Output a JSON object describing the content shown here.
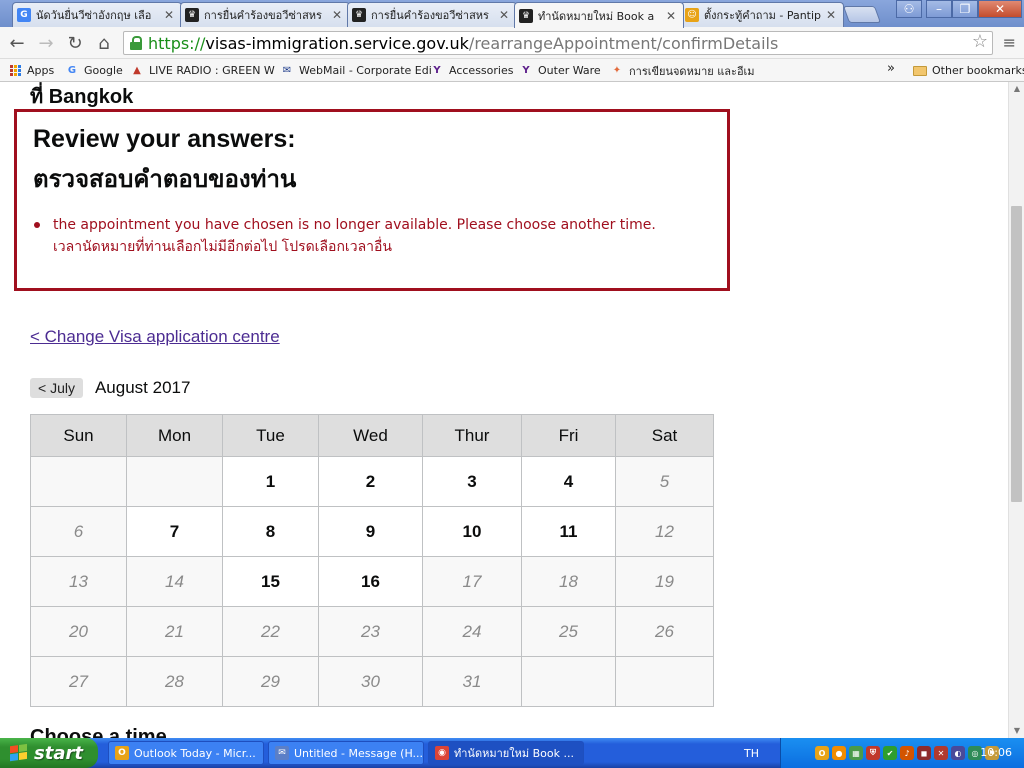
{
  "browser": {
    "tabs": [
      {
        "title": "นัดวันยื่นวีซ่าอังกฤษ เลือ",
        "icon_text": "G",
        "icon_color": "#4285f4",
        "active": false
      },
      {
        "title": "การยื่นคำร้องขอวีซ่าสหร",
        "icon_text": "♛",
        "icon_color": "#222222",
        "active": false
      },
      {
        "title": "การยื่นคำร้องขอวีซ่าสหร",
        "icon_text": "♛",
        "icon_color": "#222222",
        "active": false
      },
      {
        "title": "ทำนัดหมายใหม่ Book a",
        "icon_text": "♛",
        "icon_color": "#222222",
        "active": true
      },
      {
        "title": "ตั้งกระทู้คำถาม - Pantip",
        "icon_text": "☺",
        "icon_color": "#e8a317",
        "active": false
      }
    ],
    "url": {
      "scheme": "https://",
      "host": "visas-immigration.service.gov.uk",
      "path": "/rearrangeAppointment/confirmDetails"
    },
    "bookmarks": [
      {
        "label": "Apps",
        "icon": "apps-grid-icon"
      },
      {
        "label": "Google",
        "icon_text": "G",
        "icon_color": "#4285f4"
      },
      {
        "label": "LIVE RADIO : GREEN W",
        "icon_text": "▲",
        "icon_color": "#c0392b"
      },
      {
        "label": "WebMail - Corporate Edi",
        "icon_text": "✉",
        "icon_color": "#1d3b8a"
      },
      {
        "label": "Accessories",
        "icon_text": "Y",
        "icon_color": "#5b1d8a"
      },
      {
        "label": "Outer Ware",
        "icon_text": "Y",
        "icon_color": "#5b1d8a"
      },
      {
        "label": "การเขียนจดหมาย และอีเม",
        "icon_text": "✦",
        "icon_color": "#e36b3c"
      }
    ],
    "more_bookmarks": "»",
    "other_bookmarks": "Other bookmarks"
  },
  "page": {
    "location_heading": "ที่ Bangkok",
    "error_summary": {
      "title_en": "Review your answers:",
      "title_th": "ตรวจสอบคำตอบของท่าน",
      "message_en": "the appointment you have chosen is no longer available. Please choose another time.",
      "message_th": "เวลานัดหมายที่ท่านเลือกไม่มีอีกต่อไป โปรดเลือกเวลาอื่น",
      "color": "#a00f1e"
    },
    "change_link": "< Change Visa application centre",
    "calendar": {
      "prev_button": "< July",
      "month_label": "August 2017",
      "weekdays": [
        "Sun",
        "Mon",
        "Tue",
        "Wed",
        "Thur",
        "Fri",
        "Sat"
      ],
      "weeks": [
        [
          {
            "d": "",
            "s": "blank"
          },
          {
            "d": "",
            "s": "blank"
          },
          {
            "d": "1",
            "s": "avail"
          },
          {
            "d": "2",
            "s": "avail"
          },
          {
            "d": "3",
            "s": "avail"
          },
          {
            "d": "4",
            "s": "avail"
          },
          {
            "d": "5",
            "s": "unavail"
          }
        ],
        [
          {
            "d": "6",
            "s": "unavail"
          },
          {
            "d": "7",
            "s": "avail"
          },
          {
            "d": "8",
            "s": "avail"
          },
          {
            "d": "9",
            "s": "avail"
          },
          {
            "d": "10",
            "s": "avail"
          },
          {
            "d": "11",
            "s": "avail"
          },
          {
            "d": "12",
            "s": "unavail"
          }
        ],
        [
          {
            "d": "13",
            "s": "unavail"
          },
          {
            "d": "14",
            "s": "unavail"
          },
          {
            "d": "15",
            "s": "avail"
          },
          {
            "d": "16",
            "s": "avail"
          },
          {
            "d": "17",
            "s": "unavail"
          },
          {
            "d": "18",
            "s": "unavail"
          },
          {
            "d": "19",
            "s": "unavail"
          }
        ],
        [
          {
            "d": "20",
            "s": "unavail"
          },
          {
            "d": "21",
            "s": "unavail"
          },
          {
            "d": "22",
            "s": "unavail"
          },
          {
            "d": "23",
            "s": "unavail"
          },
          {
            "d": "24",
            "s": "unavail"
          },
          {
            "d": "25",
            "s": "unavail"
          },
          {
            "d": "26",
            "s": "unavail"
          }
        ],
        [
          {
            "d": "27",
            "s": "unavail"
          },
          {
            "d": "28",
            "s": "unavail"
          },
          {
            "d": "29",
            "s": "unavail"
          },
          {
            "d": "30",
            "s": "unavail"
          },
          {
            "d": "31",
            "s": "unavail"
          },
          {
            "d": "",
            "s": "blank"
          },
          {
            "d": "",
            "s": "blank"
          }
        ]
      ]
    },
    "next_heading": "Choose a time"
  },
  "taskbar": {
    "start_label": "start",
    "tasks": [
      {
        "title": "Outlook Today - Micr...",
        "icon_text": "O",
        "icon_color": "#e8a317",
        "active": false
      },
      {
        "title": "Untitled - Message (H...",
        "icon_text": "✉",
        "icon_color": "#5b7fc7",
        "active": false
      },
      {
        "title": "ทำนัดหมายใหม่ Book ...",
        "icon_text": "◉",
        "icon_color": "#db4437",
        "active": true
      }
    ],
    "language": "TH",
    "tray_icons": [
      {
        "icon_text": "O",
        "icon_color": "#e8a317"
      },
      {
        "icon_text": "●",
        "icon_color": "#f08c00"
      },
      {
        "icon_text": "▦",
        "icon_color": "#4a9a4a"
      },
      {
        "icon_text": "⛨",
        "icon_color": "#c0392b"
      },
      {
        "icon_text": "✔",
        "icon_color": "#2e9e2e"
      },
      {
        "icon_text": "♪",
        "icon_color": "#d35400"
      },
      {
        "icon_text": "◼",
        "icon_color": "#8e2c2c"
      },
      {
        "icon_text": "✕",
        "icon_color": "#b03a2e"
      },
      {
        "icon_text": "◐",
        "icon_color": "#4a4a9a"
      },
      {
        "icon_text": "◎",
        "icon_color": "#2e8b57"
      },
      {
        "icon_text": "⚑",
        "icon_color": "#c49a3a"
      }
    ],
    "clock": "10:06"
  }
}
